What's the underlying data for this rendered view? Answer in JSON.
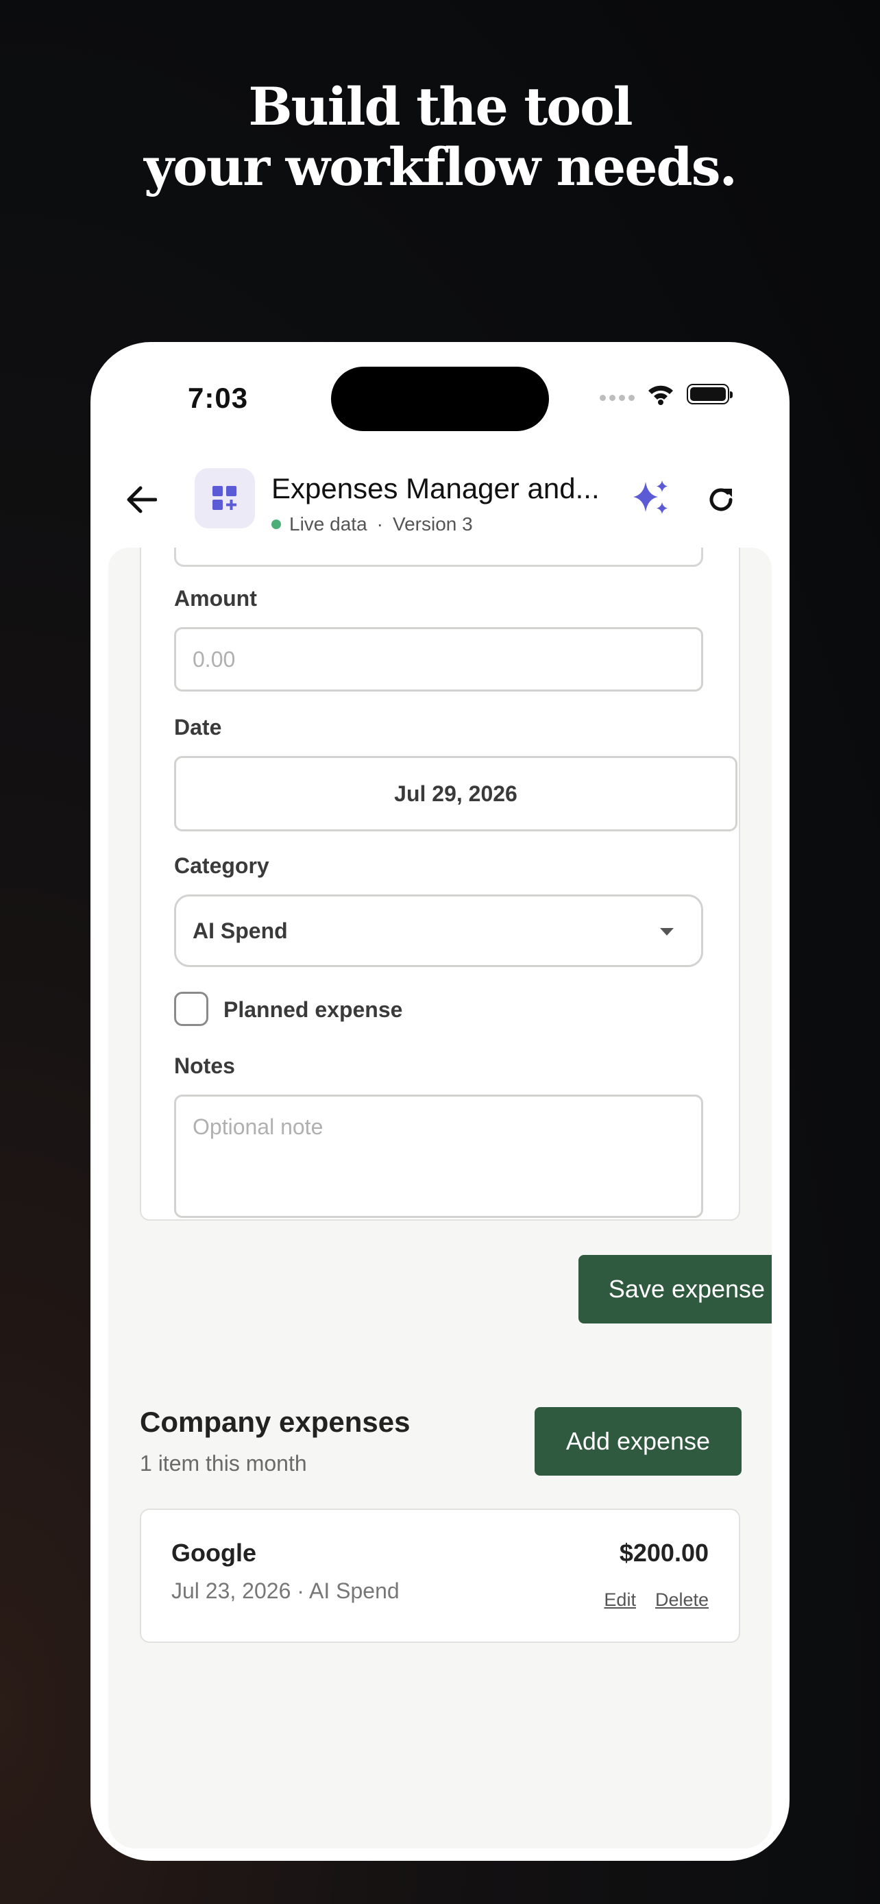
{
  "headline": {
    "line1": "Build the tool",
    "line2": "your workflow needs."
  },
  "status_bar": {
    "time": "7:03"
  },
  "header": {
    "title": "Expenses Manager and...",
    "live_label": "Live data",
    "separator": "·",
    "version": "Version 3"
  },
  "form": {
    "amount_label": "Amount",
    "amount_placeholder": "0.00",
    "date_label": "Date",
    "date_value": "Jul 29, 2026",
    "category_label": "Category",
    "category_value": "AI Spend",
    "planned_label": "Planned expense",
    "planned_checked": false,
    "notes_label": "Notes",
    "notes_placeholder": "Optional note",
    "save_label": "Save expense"
  },
  "list": {
    "title": "Company expenses",
    "subtitle": "1 item this month",
    "add_label": "Add expense",
    "items": [
      {
        "name": "Google",
        "meta": "Jul 23, 2026 · AI Spend",
        "amount": "$200.00",
        "edit_label": "Edit",
        "delete_label": "Delete"
      }
    ]
  },
  "colors": {
    "accent_green": "#305a40",
    "accent_purple": "#5b5bd6",
    "live_green": "#4caf78"
  }
}
